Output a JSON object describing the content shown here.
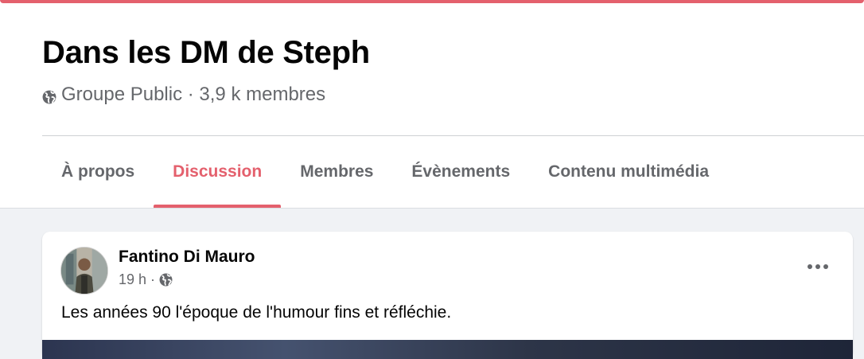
{
  "group": {
    "title": "Dans les DM de Steph",
    "privacy_icon": "globe-icon",
    "meta": "Groupe Public · 3,9 k membres"
  },
  "tabs": [
    {
      "label": "À propos",
      "active": false
    },
    {
      "label": "Discussion",
      "active": true
    },
    {
      "label": "Membres",
      "active": false
    },
    {
      "label": "Évènements",
      "active": false
    },
    {
      "label": "Contenu multimédia",
      "active": false
    }
  ],
  "post": {
    "author": "Fantino Di Mauro",
    "time": "19 h",
    "separator": "·",
    "audience_icon": "globe-icon",
    "more_icon": "more-horizontal-icon",
    "text": "Les années 90 l'époque de l'humour fins et réfléchie."
  },
  "colors": {
    "accent": "#e4606d",
    "secondary_text": "#65676b",
    "primary_text": "#050505",
    "background": "#f0f2f5"
  }
}
